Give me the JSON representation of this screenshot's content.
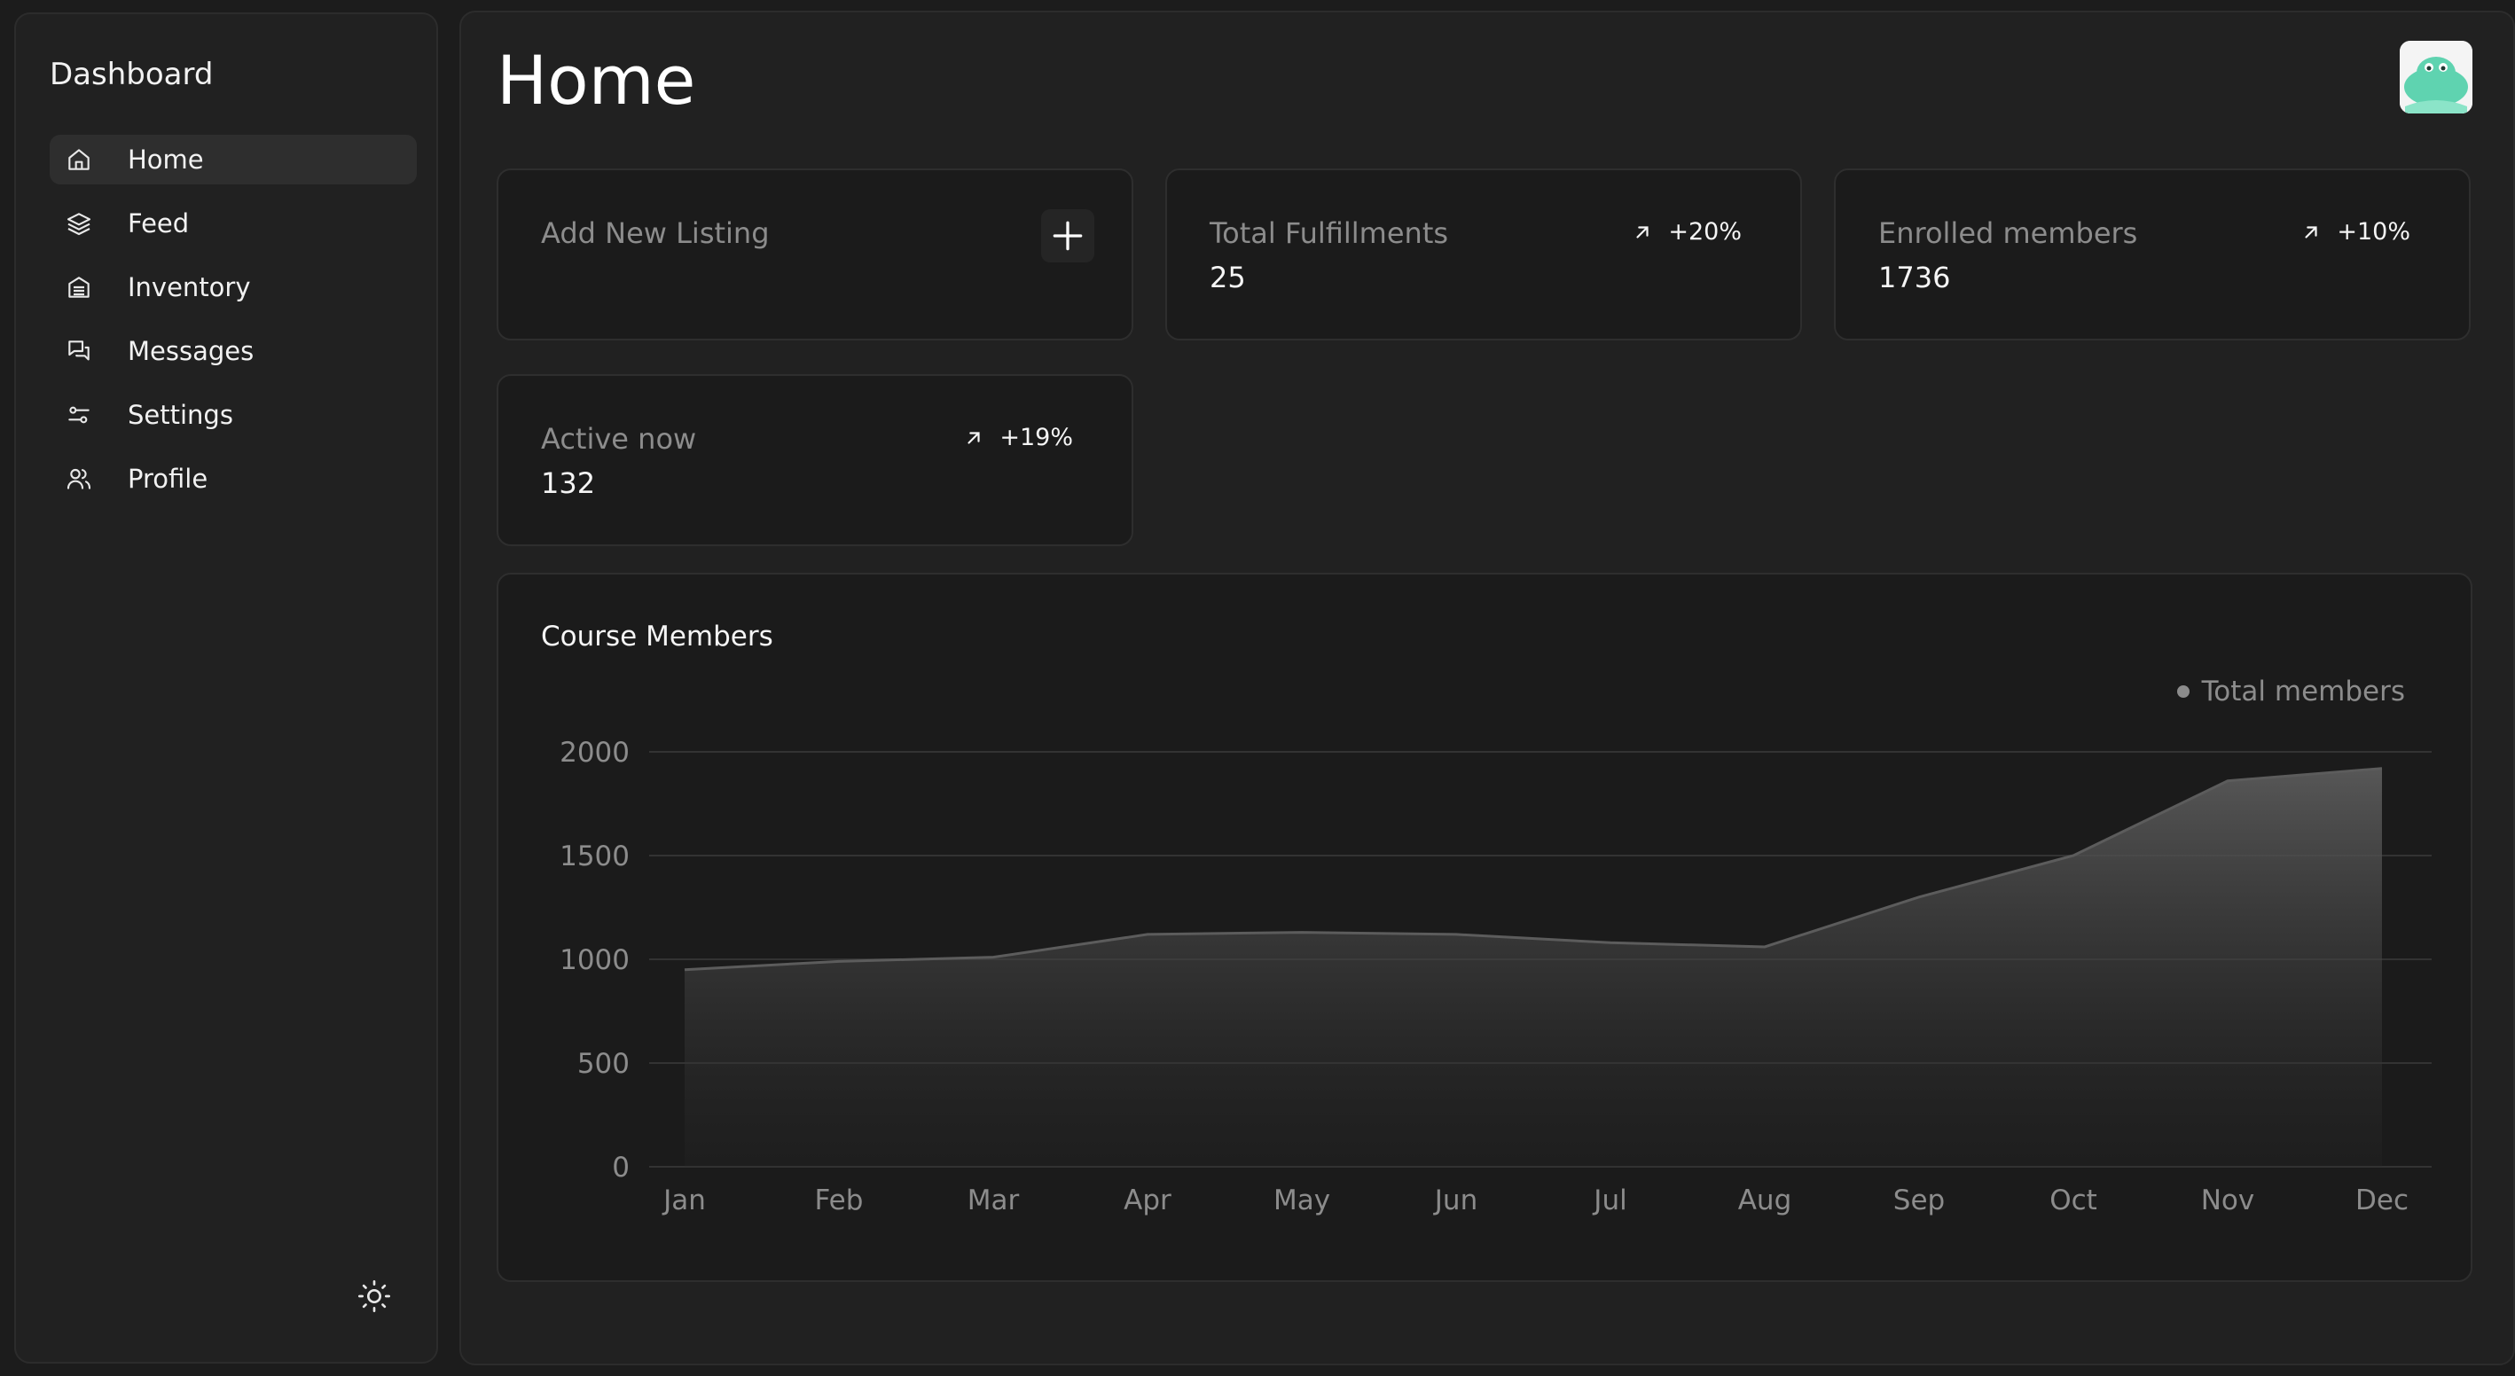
{
  "sidebar": {
    "brand": "Dashboard",
    "items": [
      {
        "label": "Home",
        "icon": "home-icon",
        "active": true
      },
      {
        "label": "Feed",
        "icon": "layers-icon",
        "active": false
      },
      {
        "label": "Inventory",
        "icon": "inventory-icon",
        "active": false
      },
      {
        "label": "Messages",
        "icon": "messages-icon",
        "active": false
      },
      {
        "label": "Settings",
        "icon": "settings-sliders-icon",
        "active": false
      },
      {
        "label": "Profile",
        "icon": "users-icon",
        "active": false
      }
    ],
    "theme_toggle_icon": "sun-icon"
  },
  "header": {
    "title": "Home",
    "avatar_icon": "frog-avatar"
  },
  "cards": {
    "add_listing": {
      "label": "Add New Listing",
      "icon": "plus-icon"
    },
    "fulfillments": {
      "label": "Total Fulfillments",
      "value": "25",
      "trend": "+20%",
      "trend_icon": "arrow-up-right-icon"
    },
    "enrolled": {
      "label": "Enrolled members",
      "value": "1736",
      "trend": "+10%",
      "trend_icon": "arrow-up-right-icon"
    },
    "active": {
      "label": "Active now",
      "value": "132",
      "trend": "+19%",
      "trend_icon": "arrow-up-right-icon"
    }
  },
  "colors": {
    "background": "#1c1c1c",
    "panel": "#212121",
    "card": "#1b1b1b",
    "accent_avatar": "#5fd3b0",
    "muted_text": "#8c8c8c"
  },
  "chart_data": {
    "type": "area",
    "title": "Course Members",
    "categories": [
      "Jan",
      "Feb",
      "Mar",
      "Apr",
      "May",
      "Jun",
      "Jul",
      "Aug",
      "Sep",
      "Oct",
      "Nov",
      "Dec"
    ],
    "series": [
      {
        "name": "Total members",
        "values": [
          950,
          990,
          1010,
          1120,
          1130,
          1120,
          1080,
          1060,
          1300,
          1500,
          1860,
          1920
        ]
      }
    ],
    "y_ticks": [
      "0",
      "500",
      "1000",
      "1500",
      "2000"
    ],
    "ylim": [
      0,
      2000
    ],
    "grid": true,
    "legend_position": "top-right"
  }
}
